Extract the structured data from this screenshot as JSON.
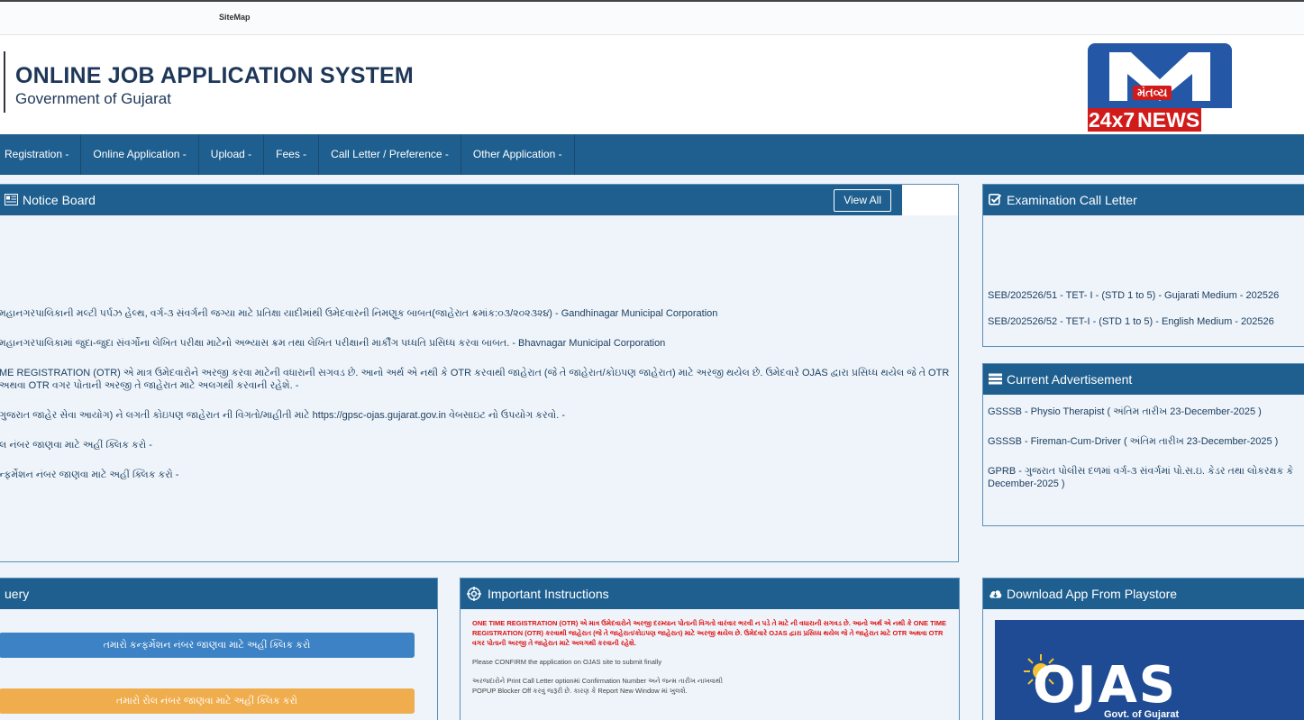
{
  "top_strip": {
    "sitemap": "SiteMap"
  },
  "header": {
    "title": "ONLINE JOB APPLICATION SYSTEM",
    "subtitle": "Government of Gujarat"
  },
  "logo": {
    "gujarati": "મંતવ્ય",
    "part1": "24x7",
    "part2": "NEWS"
  },
  "nav": [
    "Registration -",
    "Online Application -",
    "Upload -",
    "Fees -",
    "Call Letter / Preference -",
    "Other Application -"
  ],
  "notice_board": {
    "title": "Notice Board",
    "view_all": "View All",
    "items": [
      "મહાનગરપાલિકાની મલ્ટી પર્પઝ હેલ્થ, વર્ગ-૩ સંવર્ગની જગ્યા માટે પ્રતિક્ષા યાદીમાંથી ઉમેદવારની નિમણૂક બાબત(જાહેરાત ક્રમાંક:૦૩/૨૦૨૩૨૪) - Gandhinagar Municipal Corporation",
      "મહાનગરપાલિકામાં જુદા-જુદા સંવર્ગોના લેખિત પરીક્ષા માટેનો અભ્યાસ ક્રમ તથા લેખિત પરીક્ષાની માર્કીંગ પધ્ધતિ પ્રસિધ્ધ કરવા બાબત. - Bhavnagar Municipal Corporation",
      "ME REGISTRATION (OTR) એ માત્ર ઉમેદવારોને અરજી કરવા માટેની વધારાની સગવડ છે. આનો અર્થ એ નથી કે OTR કરવાથી જાહેરાત (જે તે જાહેરાત/કોઇપણ જાહેરાત) માટે અરજી થયેલ છે. ઉમેદવારે OJAS દ્વારા પ્રસિધ્ધ થયેલ જે તે OTR અથવા OTR વગર પોતાની અરજી તે જાહેરાત માટે અલગથી કરવાની રહેશે. -",
      "ગુજરાત જાહેર સેવા આયોગ) ને લગતી કોઇપણ જાહેરાત ની વિગતો/માહીતી માટે https://gpsc-ojas.gujarat.gov.in વેબસાઇટ નો ઉપયોગ કરવો. -",
      "લ નંબર જાણવા માટે અહીં ક્લિક કરો -",
      "ન્ફર્મેશન નંબર જાણવા માટે અહીં ક્લિક કરો -"
    ]
  },
  "exam_call_letter": {
    "title": "Examination Call Letter",
    "items": [
      "SEB/202526/51 - TET- I - (STD 1 to 5) - Gujarati Medium - 202526",
      "SEB/202526/52 - TET-I - (STD 1 to 5) - English Medium - 202526"
    ]
  },
  "current_advertisement": {
    "title": "Current Advertisement",
    "items": [
      "GSSSB - Physio Therapist ( અંતિમ તારીખ 23-December-2025 )",
      "GSSSB - Fireman-Cum-Driver ( અંતિમ તારીખ 23-December-2025 )",
      "GPRB - ગુજરાત પોલીસ દળમાં વર્ગ-૩ સંવર્ગમાં પો.સ.ઇ. કેડર તથા લોકરક્ષક કે December-2025 )"
    ]
  },
  "query": {
    "title": "uery",
    "confirmation_button": "તમારો કન્ફર્મેશન નંબર જાણવા માટે અહીં ક્લિક કરો",
    "roll_button": "તમારો રોલ નંબર જાણવા માટે અહીં ક્લિક કરો"
  },
  "important_instructions": {
    "title": "Important Instructions",
    "red_text": "ONE TIME REGISTRATION (OTR) એ માત્ર ઉમેદવારોને અરજી દરમ્યાન પોતાની વિગતો વારંવાર ભરવી ન પડે તે માટે ની વધારાની સગવડ છે. આનો અર્થ એ નથી કે ONE TIME REGISTRATION (OTR) કરવાથી જાહેરાત (જે તે જાહેરાત/કોઇપણ જાહેરાત) માટે અરજી થયેલ છે. ઉમેદવારે OJAS દ્વારા પ્રસિધ્ધ થયેલ જે તે જાહેરાત માટે OTR અથવા OTR વગર પોતાની અરજી તે જાહેરાત માટે અલગથી કરવાની રહેશે.",
    "confirm_text": "Please CONFIRM the application on OJAS site to submit finally",
    "print_line1": "અરજદારોને Print Call Letter optionમાં Confirmation Number અને જન્મ તારીખ નાખવાથી",
    "print_line2": "POPUP Blocker Off કરવું જરૂરી છે. કારણ કે Report New Window માં ખુલશે."
  },
  "download_app": {
    "title": "Download App From Playstore",
    "banner_text": "OJAS",
    "banner_sub": "Govt. of Gujarat"
  },
  "colors": {
    "nav_bg": "#1e5f8f",
    "panel_bg": "#eef4fa",
    "accent_blue": "#3d82c4",
    "accent_orange": "#f0ad4e",
    "alert_red": "#e01010"
  }
}
